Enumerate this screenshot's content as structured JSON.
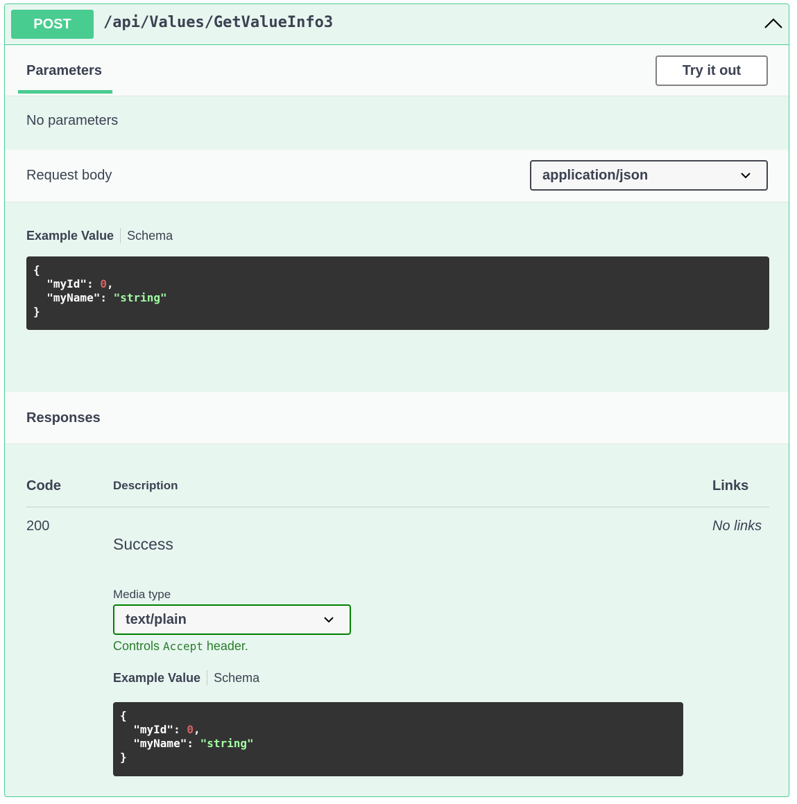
{
  "operation": {
    "method": "POST",
    "path": "/api/Values/GetValueInfo3"
  },
  "parameters": {
    "tab_label": "Parameters",
    "try_button": "Try it out",
    "empty_text": "No parameters"
  },
  "request_body": {
    "label": "Request body",
    "content_type": "application/json",
    "example_tab": "Example Value",
    "schema_tab": "Schema",
    "example": {
      "open": "{",
      "line1_key": "\"myId\"",
      "line1_colon": ": ",
      "line1_value": "0",
      "line1_comma": ",",
      "line2_key": "\"myName\"",
      "line2_colon": ": ",
      "line2_value": "\"string\"",
      "close": "}"
    }
  },
  "responses": {
    "title": "Responses",
    "col_code": "Code",
    "col_description": "Description",
    "col_links": "Links",
    "row": {
      "code": "200",
      "description": "Success",
      "links": "No links",
      "media_type_label": "Media type",
      "media_type": "text/plain",
      "controls_prefix": "Controls",
      "controls_code": "Accept",
      "controls_suffix": "header.",
      "example_tab": "Example Value",
      "schema_tab": "Schema",
      "example": {
        "open": "{",
        "line1_key": "\"myId\"",
        "line1_colon": ": ",
        "line1_value": "0",
        "line1_comma": ",",
        "line2_key": "\"myName\"",
        "line2_colon": ": ",
        "line2_value": "\"string\"",
        "close": "}"
      }
    }
  },
  "colors": {
    "post_green": "#49cc90",
    "block_bg": "#e8f6f0",
    "code_bg": "#333333",
    "number": "#d36363",
    "string": "#a2fca2"
  }
}
